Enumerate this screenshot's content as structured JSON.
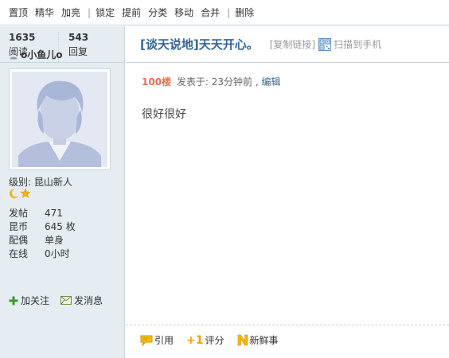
{
  "modbar": {
    "pin": "置顶",
    "digest": "精华",
    "highlight": "加亮",
    "lock": "锁定",
    "bump": "提前",
    "category": "分类",
    "move": "移动",
    "merge": "合并",
    "delete": "删除"
  },
  "stats": {
    "views": "1635",
    "views_label": "阅读",
    "replies": "543",
    "replies_label": "回复"
  },
  "thread": {
    "title": "[谈天说地]天天开心。",
    "copy_link": "[复制链接]",
    "scan_to_phone": "扫描到手机"
  },
  "author": {
    "name": "o小鱼儿o",
    "level_key": "级别:",
    "level_value": "昆山新人",
    "posts_key": "发帖",
    "posts_value": "471",
    "coins_key": "昆币",
    "coins_value": "645 枚",
    "spouse_key": "配偶",
    "spouse_value": "单身",
    "online_key": "在线",
    "online_value": "0小时",
    "follow_label": "加关注",
    "message_label": "发消息"
  },
  "post": {
    "floor": "100楼",
    "posted_at": "发表于: 23分钟前 ,",
    "edit": "编辑",
    "content": "很好很好"
  },
  "footer": {
    "quote": "引用",
    "rate": "评分",
    "new": "新鲜事"
  },
  "colors": {
    "accent": "#336699",
    "floor": "#f26c4f",
    "side_bg": "#e5edf2",
    "border": "#c2d5e3"
  }
}
